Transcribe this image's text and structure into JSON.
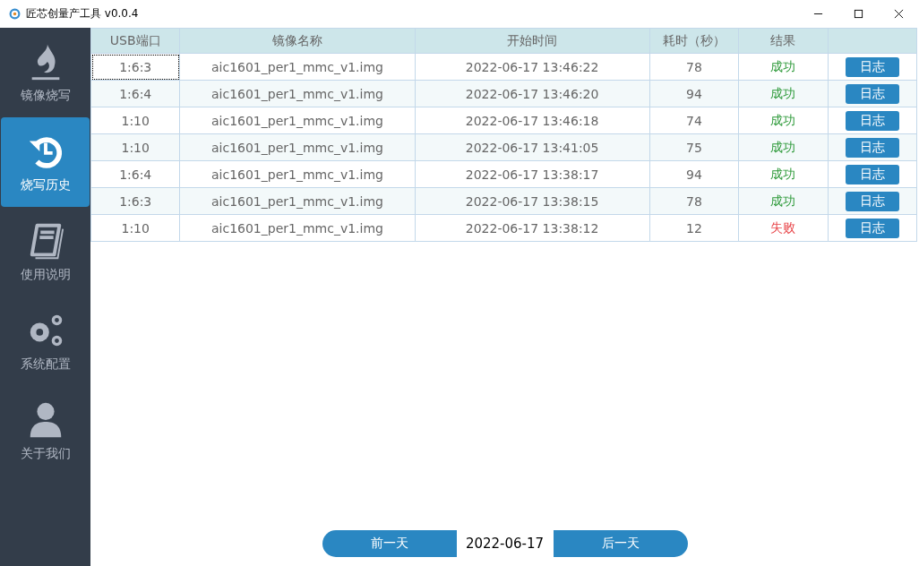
{
  "window": {
    "title": "匠芯创量产工具 v0.0.4"
  },
  "sidebar": {
    "items": [
      {
        "label": "镜像烧写",
        "selected": false
      },
      {
        "label": "烧写历史",
        "selected": true
      },
      {
        "label": "使用说明",
        "selected": false
      },
      {
        "label": "系统配置",
        "selected": false
      },
      {
        "label": "关于我们",
        "selected": false
      }
    ]
  },
  "table": {
    "columns": [
      "USB端口",
      "镜像名称",
      "开始时间",
      "耗时（秒）",
      "结果"
    ],
    "rows": [
      {
        "port": "1:6:3",
        "image": "aic1601_per1_mmc_v1.img",
        "start": "2022-06-17 13:46:22",
        "duration": "78",
        "result": "成功",
        "kind": "success",
        "focused": true,
        "action": "日志"
      },
      {
        "port": "1:6:4",
        "image": "aic1601_per1_mmc_v1.img",
        "start": "2022-06-17 13:46:20",
        "duration": "94",
        "result": "成功",
        "kind": "success",
        "focused": false,
        "action": "日志"
      },
      {
        "port": "1:10",
        "image": "aic1601_per1_mmc_v1.img",
        "start": "2022-06-17 13:46:18",
        "duration": "74",
        "result": "成功",
        "kind": "success",
        "focused": false,
        "action": "日志"
      },
      {
        "port": "1:10",
        "image": "aic1601_per1_mmc_v1.img",
        "start": "2022-06-17 13:41:05",
        "duration": "75",
        "result": "成功",
        "kind": "success",
        "focused": false,
        "action": "日志"
      },
      {
        "port": "1:6:4",
        "image": "aic1601_per1_mmc_v1.img",
        "start": "2022-06-17 13:38:17",
        "duration": "94",
        "result": "成功",
        "kind": "success",
        "focused": false,
        "action": "日志"
      },
      {
        "port": "1:6:3",
        "image": "aic1601_per1_mmc_v1.img",
        "start": "2022-06-17 13:38:15",
        "duration": "78",
        "result": "成功",
        "kind": "success",
        "focused": false,
        "action": "日志"
      },
      {
        "port": "1:10",
        "image": "aic1601_per1_mmc_v1.img",
        "start": "2022-06-17 13:38:12",
        "duration": "12",
        "result": "失败",
        "kind": "failure",
        "focused": false,
        "action": "日志"
      }
    ]
  },
  "pager": {
    "prev": "前一天",
    "date": "2022-06-17",
    "next": "后一天"
  }
}
